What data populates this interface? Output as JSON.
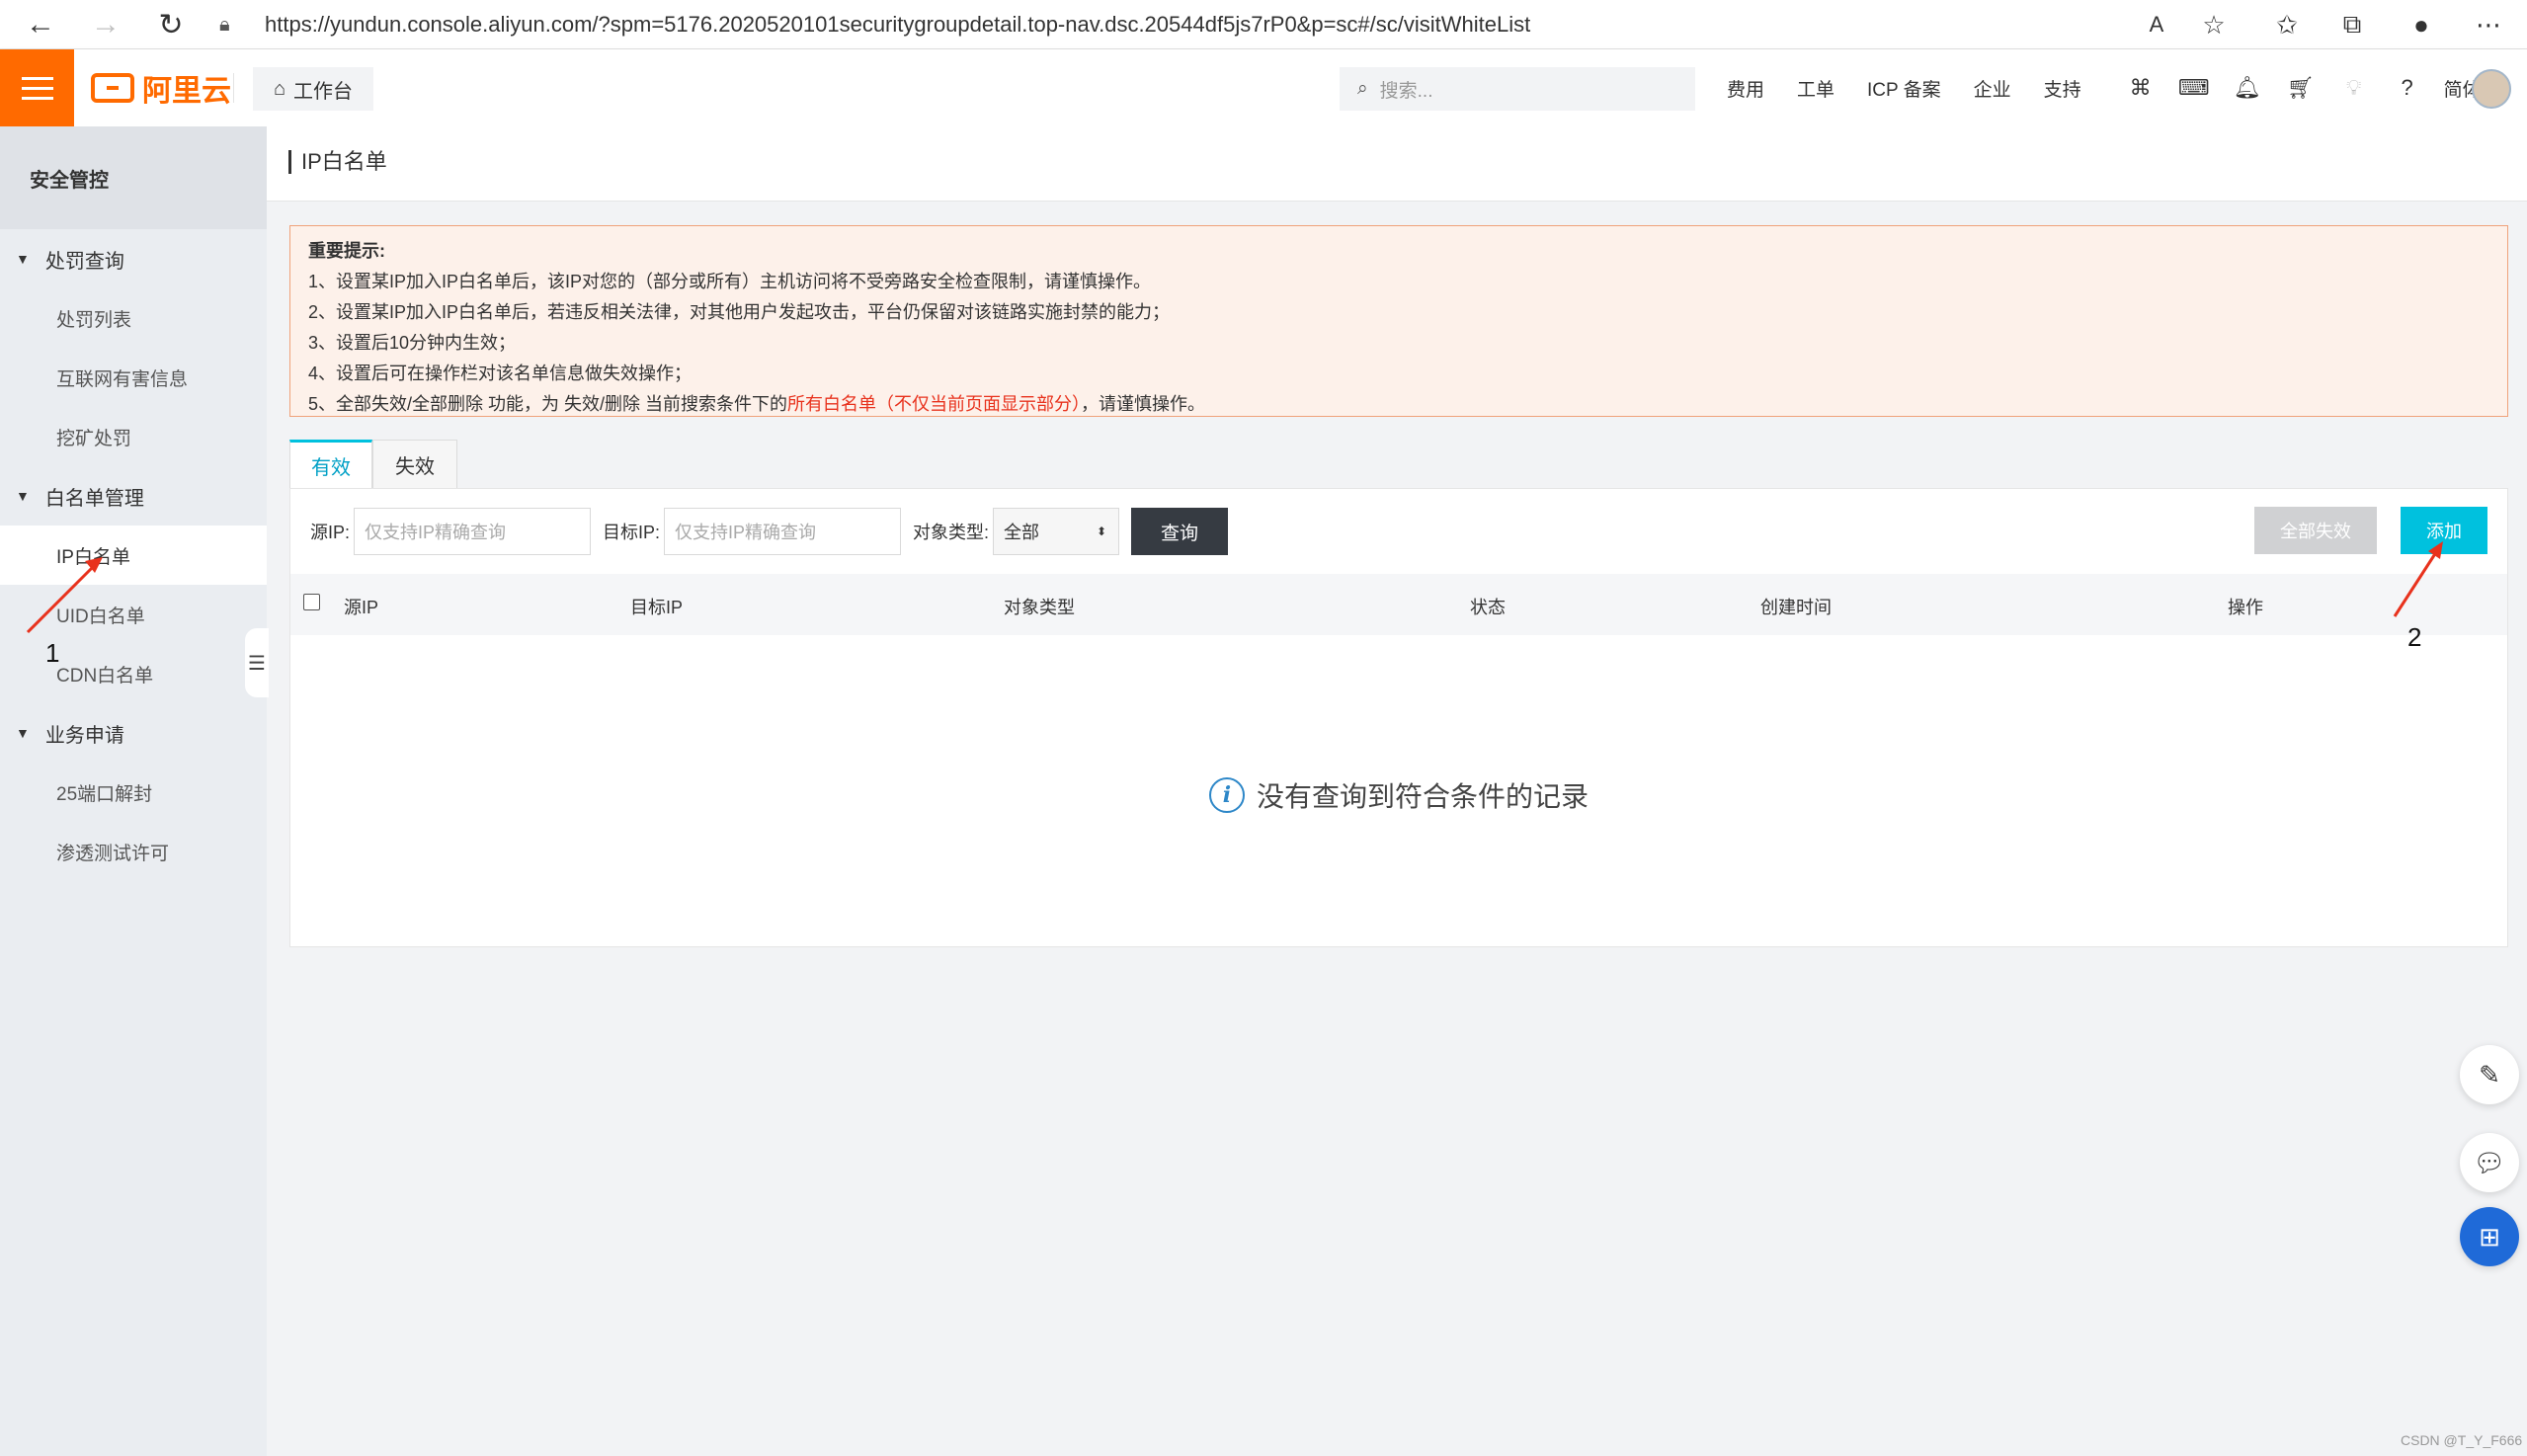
{
  "browser": {
    "url": "https://yundun.console.aliyun.com/?spm=5176.2020520101securitygroupdetail.top-nav.dsc.20544df5js7rP0&p=sc#/sc/visitWhiteList"
  },
  "topnav": {
    "logo": "阿里云",
    "workbench": "工作台",
    "search_placeholder": "搜索...",
    "items": [
      "费用",
      "工单",
      "ICP 备案",
      "企业",
      "支持"
    ],
    "lang": "简体"
  },
  "sidebar": {
    "title": "安全管控",
    "groups": [
      {
        "label": "处罚查询",
        "items": [
          "处罚列表",
          "互联网有害信息",
          "挖矿处罚"
        ]
      },
      {
        "label": "白名单管理",
        "items": [
          "IP白名单",
          "UID白名单",
          "CDN白名单"
        ]
      },
      {
        "label": "业务申请",
        "items": [
          "25端口解封",
          "渗透测试许可"
        ]
      }
    ]
  },
  "page": {
    "title": "IP白名单"
  },
  "notice": {
    "title": "重要提示:",
    "line1": "1、设置某IP加入IP白名单后，该IP对您的（部分或所有）主机访问将不受旁路安全检查限制，请谨慎操作。",
    "line2": "2、设置某IP加入IP白名单后，若违反相关法律，对其他用户发起攻击，平台仍保留对该链路实施封禁的能力；",
    "line3": "3、设置后10分钟内生效；",
    "line4": "4、设置后可在操作栏对该名单信息做失效操作；",
    "line5_pre": "5、全部失效/全部删除 功能，为 失效/删除 当前搜索条件下的",
    "line5_red": "所有白名单（不仅当前页面显示部分）",
    "line5_post": "，请谨慎操作。"
  },
  "tabs": [
    "有效",
    "失效"
  ],
  "filters": {
    "src_label": "源IP:",
    "src_placeholder": "仅支持IP精确查询",
    "dst_label": "目标IP:",
    "dst_placeholder": "仅支持IP精确查询",
    "type_label": "对象类型:",
    "type_value": "全部",
    "query_button": "查询",
    "disable_all_button": "全部失效",
    "add_button": "添加"
  },
  "table": {
    "columns": [
      "源IP",
      "目标IP",
      "对象类型",
      "状态",
      "创建时间",
      "操作"
    ],
    "empty_text": "没有查询到符合条件的记录"
  },
  "annotations": [
    "1",
    "2"
  ],
  "watermark": "CSDN @T_Y_F666",
  "colors": {
    "brand": "#ff6a00",
    "accent": "#00c1de",
    "notice_bg": "#fdf1ea",
    "arrow": "#e8321d"
  }
}
